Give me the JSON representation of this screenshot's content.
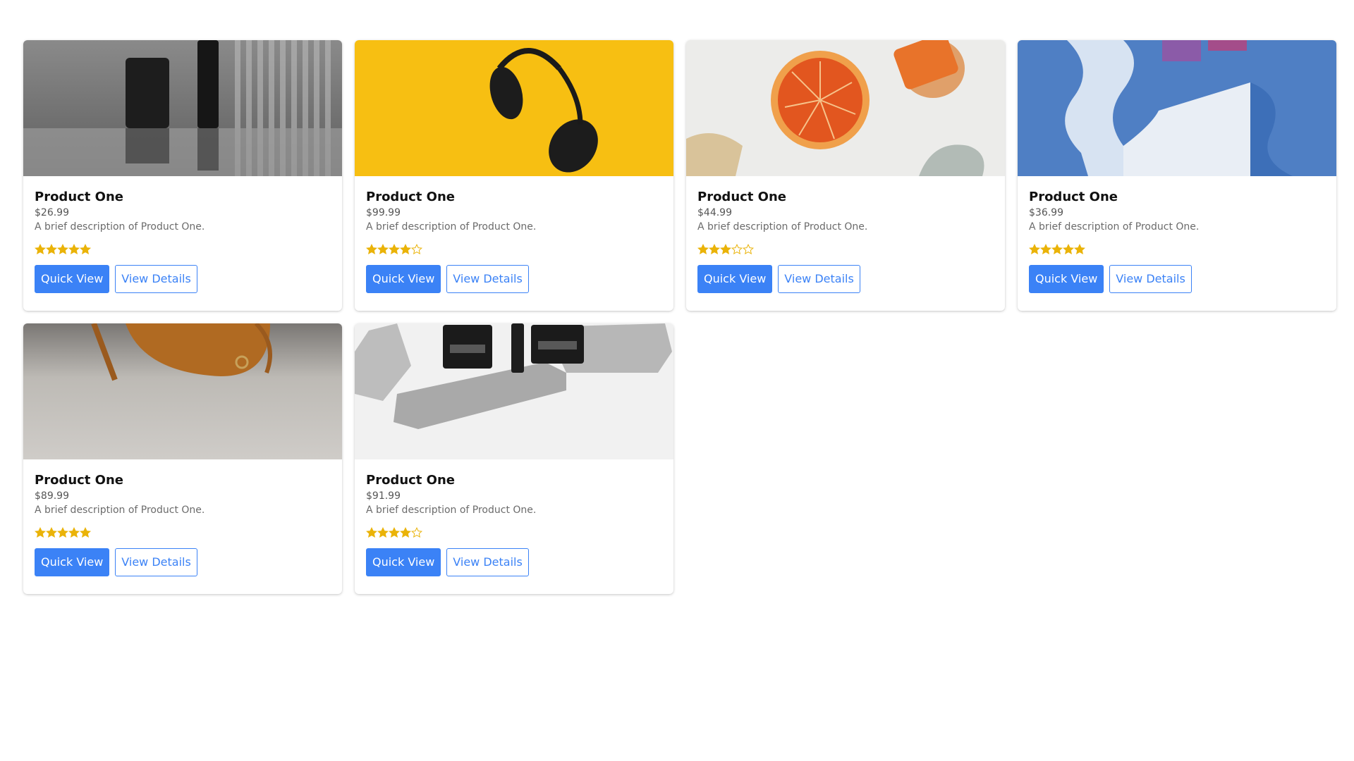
{
  "colors": {
    "accent": "#3b82f6",
    "star": "#eab308"
  },
  "products": [
    {
      "name": "Product One",
      "price": "$26.99",
      "description": "A brief description of Product One.",
      "rating": 5,
      "image": "skincare-jars-gray",
      "quick_view": "Quick View",
      "view_details": "View Details"
    },
    {
      "name": "Product One",
      "price": "$99.99",
      "description": "A brief description of Product One.",
      "rating": 4,
      "image": "headphones-yellow",
      "quick_view": "Quick View",
      "view_details": "View Details"
    },
    {
      "name": "Product One",
      "price": "$44.99",
      "description": "A brief description of Product One.",
      "rating": 3,
      "image": "orange-slice-cosmetics",
      "quick_view": "Quick View",
      "view_details": "View Details"
    },
    {
      "name": "Product One",
      "price": "$36.99",
      "description": "A brief description of Product One.",
      "rating": 5,
      "image": "blue-abstract-shapes",
      "quick_view": "Quick View",
      "view_details": "View Details"
    },
    {
      "name": "Product One",
      "price": "$89.99",
      "description": "A brief description of Product One.",
      "rating": 5,
      "image": "leather-bag",
      "quick_view": "Quick View",
      "view_details": "View Details"
    },
    {
      "name": "Product One",
      "price": "$91.99",
      "description": "A brief description of Product One.",
      "rating": 4,
      "image": "skincare-on-stone",
      "quick_view": "Quick View",
      "view_details": "View Details"
    }
  ]
}
